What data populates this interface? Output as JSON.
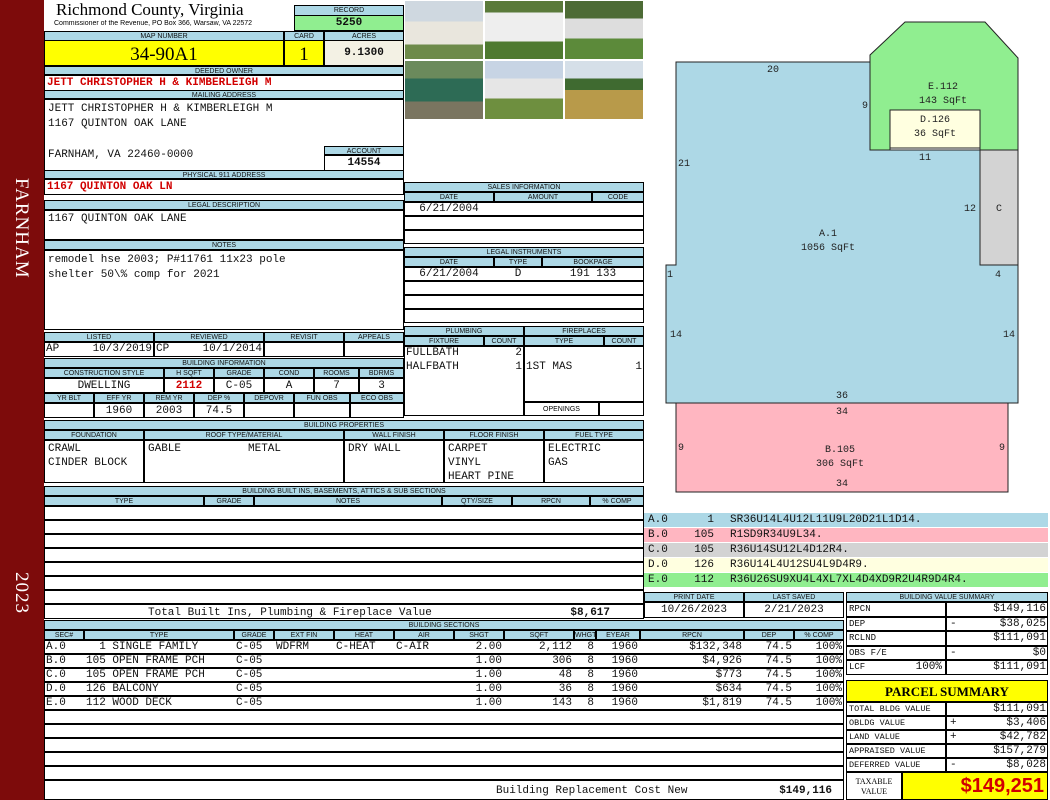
{
  "sidebar": {
    "town": "FARNHAM",
    "year": "2023"
  },
  "header": {
    "title": "Richmond County, Virginia",
    "subtitle": "Commissioner of the Revenue, PO Box 366, Warsaw, VA 22572",
    "record_label": "RECORD",
    "record": "5250"
  },
  "parcel": {
    "map_label": "MAP NUMBER",
    "map": "34-90A1",
    "card_label": "CARD",
    "card": "1",
    "acres_label": "ACRES",
    "acres": "9.1300"
  },
  "owner": {
    "label": "DEEDED OWNER",
    "name": "JETT CHRISTOPHER H & KIMBERLEIGH M",
    "mail_label": "MAILING ADDRESS",
    "mail_lines": [
      "JETT CHRISTOPHER H & KIMBERLEIGH M",
      "1167 QUINTON OAK LANE",
      "FARNHAM, VA 22460-0000"
    ],
    "account_label": "ACCOUNT",
    "account": "14554",
    "physical_label": "PHYSICAL 911 ADDRESS",
    "physical": "1167 QUINTON OAK LN"
  },
  "legal": {
    "label": "LEGAL DESCRIPTION",
    "text": "1167 QUINTON OAK LANE"
  },
  "notes": {
    "label": "NOTES",
    "lines": [
      "remodel hse 2003; P#11761 11x23 pole",
      "shelter 50\\% comp for 2021"
    ]
  },
  "review": {
    "headers": [
      "LISTED",
      "REVIEWED",
      "REVISIT",
      "APPEALS"
    ],
    "listed_by": "AP",
    "listed_date": "10/3/2019",
    "reviewed_by": "CP",
    "reviewed_date": "10/1/2014"
  },
  "building_info": {
    "label": "BUILDING INFORMATION",
    "headers1": [
      "CONSTRUCTION STYLE",
      "H SQFT",
      "GRADE",
      "COND",
      "ROOMS",
      "BDRMS"
    ],
    "values1": [
      "DWELLING",
      "2112",
      "C-05",
      "A",
      "7",
      "3"
    ],
    "headers2": [
      "YR BLT",
      "EFF YR",
      "REM YR",
      "DEP %",
      "DEPOVR",
      "FUN OBS",
      "ECO OBS"
    ],
    "values2": [
      "",
      "1960",
      "2003",
      "74.5",
      "",
      "",
      ""
    ]
  },
  "sales": {
    "label": "SALES INFORMATION",
    "headers": [
      "DATE",
      "AMOUNT",
      "CODE"
    ],
    "rows": [
      [
        "6/21/2004",
        "",
        ""
      ],
      [
        "",
        "",
        ""
      ],
      [
        "",
        "",
        ""
      ]
    ]
  },
  "instruments": {
    "label": "LEGAL INSTRUMENTS",
    "headers": [
      "DATE",
      "TYPE",
      "BOOKPAGE"
    ],
    "rows": [
      [
        "6/21/2004",
        "D",
        "191 133"
      ],
      [
        "",
        "",
        ""
      ],
      [
        "",
        "",
        ""
      ],
      [
        "",
        "",
        ""
      ]
    ]
  },
  "plumbing": {
    "label": "PLUMBING",
    "headers": [
      "FIXTURE",
      "COUNT"
    ],
    "rows": [
      [
        "FULLBATH",
        "2"
      ],
      [
        "HALFBATH",
        "1"
      ],
      [
        "",
        ""
      ],
      [
        "",
        ""
      ]
    ]
  },
  "fireplaces": {
    "label": "FIREPLACES",
    "headers": [
      "TYPE",
      "COUNT"
    ],
    "rows": [
      [
        "",
        ""
      ],
      [
        "1ST MAS",
        "1"
      ],
      [
        "",
        ""
      ]
    ],
    "openings_label": "OPENINGS"
  },
  "properties": {
    "label": "BUILDING PROPERTIES",
    "headers": [
      "FOUNDATION",
      "ROOF TYPE/MATERIAL",
      "WALL FINISH",
      "FLOOR FINISH",
      "FUEL TYPE"
    ],
    "foundation": [
      "CRAWL",
      "CINDER BLOCK"
    ],
    "roof_type": "GABLE",
    "roof_material": "METAL",
    "wall": [
      "DRY WALL"
    ],
    "floor": [
      "CARPET",
      "VINYL",
      "HEART PINE"
    ],
    "fuel": [
      "ELECTRIC",
      "GAS"
    ]
  },
  "builtins": {
    "label": "BUILDING BUILT INS, BASEMENTS, ATTICS & SUB SECTIONS",
    "headers": [
      "TYPE",
      "GRADE",
      "NOTES",
      "QTY/SIZE",
      "RPCN",
      "% COMP"
    ],
    "total_label": "Total Built Ins, Plumbing & Fireplace Value",
    "total": "$8,617"
  },
  "sketch": {
    "labels": {
      "a": "A.1",
      "a_area": "1056 SqFt",
      "b": "B.105",
      "b_area": "306 SqFt",
      "c": "C",
      "d": "D.126",
      "d_area": "36 SqFt",
      "e": "E.112",
      "e_area": "143 SqFt"
    },
    "dims": [
      "20",
      "9",
      "21",
      "11",
      "12",
      "1",
      "4",
      "14",
      "14",
      "36",
      "34",
      "9",
      "9",
      "34"
    ],
    "colors": {
      "a": "#add8e6",
      "b": "#ffb6c1",
      "c": "#d3d3d3",
      "d": "#ffffe0",
      "e": "#90ee90"
    }
  },
  "legend": [
    {
      "sec": "A.0",
      "code": "1",
      "path": "SR36U14L4U12L11U9L20D21L1D14.",
      "color": "#add8e6"
    },
    {
      "sec": "B.0",
      "code": "105",
      "path": "R1SD9R34U9L34.",
      "color": "#ffb6c1"
    },
    {
      "sec": "C.0",
      "code": "105",
      "path": "R36U14SU12L4D12R4.",
      "color": "#d3d3d3"
    },
    {
      "sec": "D.0",
      "code": "126",
      "path": "R36U14L4U12SU4L9D4R9.",
      "color": "#ffffe0"
    },
    {
      "sec": "E.0",
      "code": "112",
      "path": "R36U26SU9XU4L4XL7XL4D4XD9R2U4R9D4R4.",
      "color": "#90ee90"
    }
  ],
  "dates": {
    "print_label": "PRINT DATE",
    "print": "10/26/2023",
    "saved_label": "LAST SAVED",
    "saved": "2/21/2023"
  },
  "sections": {
    "label": "BUILDING SECTIONS",
    "headers": [
      "SEC#",
      "TYPE",
      "GRADE",
      "EXT FIN",
      "HEAT",
      "AIR",
      "SHGT",
      "SQFT",
      "WHGT",
      "EYEAR",
      "RPCN",
      "DEP",
      "% COMP"
    ],
    "rows": [
      [
        "A.0",
        "  1 SINGLE FAMILY",
        "C-05",
        "WDFRM",
        "C-HEAT",
        "C-AIR",
        "2.00",
        "2,112",
        "8",
        "1960",
        "$132,348",
        "74.5",
        "100%"
      ],
      [
        "B.0",
        "105 OPEN FRAME PCH",
        "C-05",
        "",
        "",
        "",
        "1.00",
        "306",
        "8",
        "1960",
        "$4,926",
        "74.5",
        "100%"
      ],
      [
        "C.0",
        "105 OPEN FRAME PCH",
        "C-05",
        "",
        "",
        "",
        "1.00",
        "48",
        "8",
        "1960",
        "$773",
        "74.5",
        "100%"
      ],
      [
        "D.0",
        "126 BALCONY",
        "C-05",
        "",
        "",
        "",
        "1.00",
        "36",
        "8",
        "1960",
        "$634",
        "74.5",
        "100%"
      ],
      [
        "E.0",
        "112 WOOD DECK",
        "C-05",
        "",
        "",
        "",
        "1.00",
        "143",
        "8",
        "1960",
        "$1,819",
        "74.5",
        "100%"
      ]
    ],
    "total_label": "Building Replacement Cost New",
    "total": "$149,116"
  },
  "value_summary": {
    "label": "BUILDING VALUE SUMMARY",
    "rows": [
      {
        "label": "RPCN",
        "extra": "",
        "sign": "",
        "value": "$149,116"
      },
      {
        "label": "DEP",
        "extra": "",
        "sign": "-",
        "value": "$38,025"
      },
      {
        "label": "RCLND",
        "extra": "",
        "sign": "",
        "value": "$111,091"
      },
      {
        "label": "OBS F/E",
        "extra": "",
        "sign": "-",
        "value": "$0"
      },
      {
        "label": "LCF",
        "extra": "100%",
        "sign": "",
        "value": "$111,091"
      }
    ]
  },
  "parcel_summary": {
    "title": "PARCEL SUMMARY",
    "rows": [
      {
        "label": "TOTAL BLDG VALUE",
        "sign": "",
        "value": "$111,091"
      },
      {
        "label": "OBLDG VALUE",
        "sign": "+",
        "value": "$3,406"
      },
      {
        "label": "LAND VALUE",
        "sign": "+",
        "value": "$42,782"
      },
      {
        "label": "APPRAISED VALUE",
        "sign": "",
        "value": "$157,279"
      },
      {
        "label": "DEFERRED VALUE",
        "sign": "-",
        "value": "$8,028"
      }
    ],
    "taxable_label": "TAXABLE\nVALUE",
    "taxable": "$149,251"
  }
}
